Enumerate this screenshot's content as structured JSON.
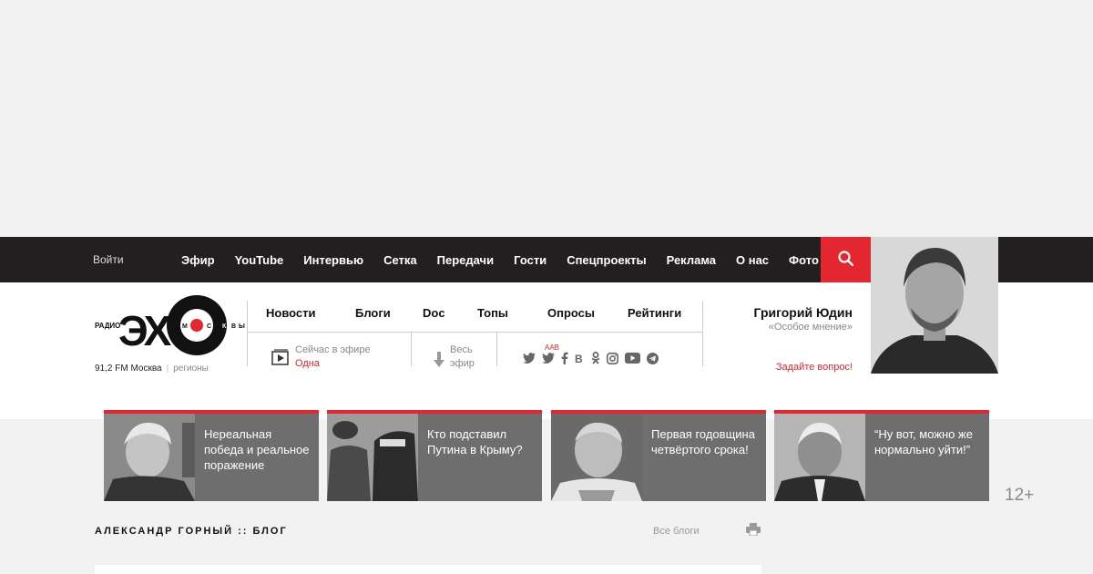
{
  "topbar": {
    "login": "Войти",
    "nav": [
      "Эфир",
      "YouTube",
      "Интервью",
      "Сетка",
      "Передачи",
      "Гости",
      "Спецпроекты",
      "Реклама",
      "О нас",
      "Фото"
    ],
    "age_rating": "12+"
  },
  "logo": {
    "left_text": "РАДИО",
    "main": "ЭХО",
    "right_text": "М О С К В Ы",
    "frequency": "91,2 FM Москва",
    "separator": "|",
    "regions": "регионы"
  },
  "subnav": [
    "Новости",
    "Блоги",
    "Doc",
    "Топы",
    "Опросы",
    "Рейтинги"
  ],
  "onair": {
    "label": "Сейчас в эфире",
    "show": "Одна"
  },
  "allair": {
    "line1": "Весь",
    "line2": "эфир"
  },
  "socials": {
    "aab": "AAB",
    "icons": [
      "twitter-icon",
      "twitter-aab-icon",
      "facebook-icon",
      "vk-icon",
      "odnoklassniki-icon",
      "instagram-icon",
      "youtube-icon",
      "telegram-icon"
    ]
  },
  "guest": {
    "name": "Григорий Юдин",
    "show": "«Особое мнение»",
    "ask": "Задайте вопрос!"
  },
  "cards": [
    {
      "title": "Нереальная победа и реальное поражение"
    },
    {
      "title": "Кто подставил Путина в Крыму?"
    },
    {
      "title": "Первая годовщина четвёртого срока!"
    },
    {
      "title": "“Ну вот, можно же нормально уйти!”"
    }
  ],
  "blog": {
    "title": "АЛЕКСАНДР ГОРНЫЙ :: БЛОГ",
    "all_blogs": "Все блоги"
  },
  "colors": {
    "accent": "#e3262f",
    "topbar": "#231f20",
    "card": "#6e6e6e"
  }
}
